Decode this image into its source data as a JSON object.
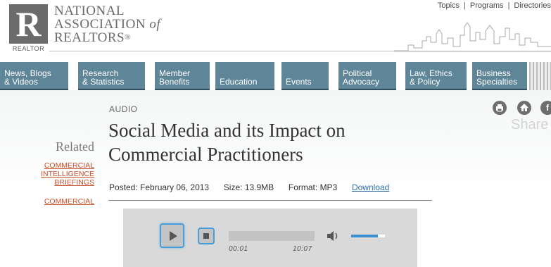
{
  "header": {
    "org_line1": "NATIONAL",
    "org_line2": "ASSOCIATION",
    "org_of": "of",
    "org_line3": "REALTORS",
    "org_reg": "®",
    "logo_letter": "R",
    "logo_caption": "REALTOR",
    "links": [
      "Topics",
      "Programs",
      "Directories"
    ],
    "link_sep": "|"
  },
  "nav": {
    "items": [
      {
        "line1": "News, Blogs",
        "line2": "& Videos"
      },
      {
        "line1": "Research",
        "line2": "& Statistics"
      },
      {
        "line1": "Member",
        "line2": "Benefits"
      },
      {
        "line1": "",
        "line2": "Education"
      },
      {
        "line1": "",
        "line2": "Events"
      },
      {
        "line1": "Political",
        "line2": "Advocacy"
      },
      {
        "line1": "Law, Ethics",
        "line2": "& Policy"
      },
      {
        "line1": "Business",
        "line2": "Specialties"
      }
    ]
  },
  "sidebar": {
    "title": "Related",
    "links": [
      "COMMERCIAL INTELLIGENCE BRIEFINGS",
      "COMMERCIAL"
    ]
  },
  "article": {
    "category": "AUDIO",
    "title": "Social Media and its Impact on Commercial Practitioners",
    "posted_label": "Posted:",
    "posted_date": "February 06, 2013",
    "size_label": "Size:",
    "size_value": "13.9MB",
    "format_label": "Format:",
    "format_value": "MP3",
    "download_label": "Download"
  },
  "share": {
    "label": "Share",
    "icons": [
      "print-icon",
      "home-icon",
      "facebook-icon"
    ],
    "facebook_glyph": "f"
  },
  "player": {
    "current_time": "00:01",
    "total_time": "10:07",
    "progress": 0.0,
    "volume": 0.8
  },
  "colors": {
    "nav_bg": "#5f8598",
    "accent_link": "#c8502b",
    "player_accent": "#3a8fce"
  }
}
